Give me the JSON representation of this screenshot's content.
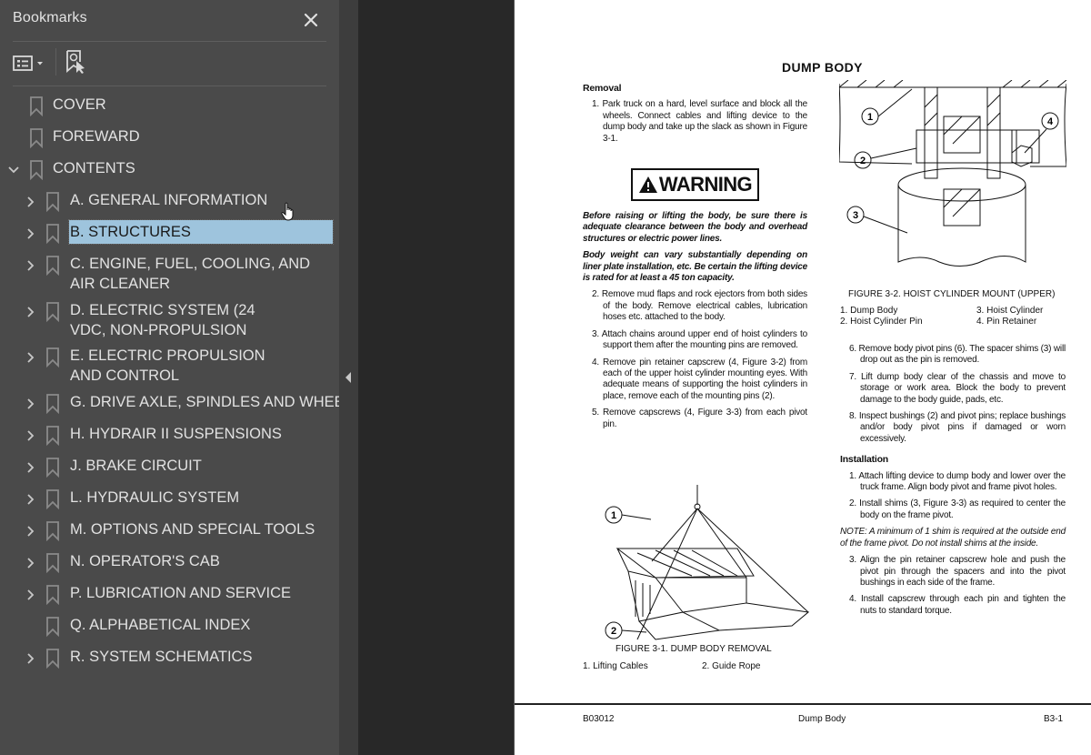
{
  "sidebar": {
    "title": "Bookmarks",
    "close_icon": "close-x-icon",
    "toolbar": {
      "options_icon": "list-options-icon",
      "find_icon": "find-current-bookmark-icon"
    },
    "items": [
      {
        "label": "COVER",
        "level": 0,
        "expandable": false,
        "expanded": false
      },
      {
        "label": "FOREWARD",
        "level": 0,
        "expandable": false,
        "expanded": false
      },
      {
        "label": "CONTENTS",
        "level": 0,
        "expandable": true,
        "expanded": true
      },
      {
        "label": "A. GENERAL INFORMATION",
        "level": 1,
        "expandable": true,
        "expanded": false
      },
      {
        "label": "B. STRUCTURES",
        "level": 1,
        "expandable": true,
        "expanded": false,
        "selected": true
      },
      {
        "label": "C. ENGINE, FUEL, COOLING, AND AIR CLEANER",
        "level": 1,
        "expandable": true,
        "expanded": false
      },
      {
        "label": "D. ELECTRIC SYSTEM (24 VDC, NON-PROPULSION",
        "level": 1,
        "expandable": true,
        "expanded": false
      },
      {
        "label": "E. ELECTRIC PROPULSION AND CONTROL",
        "level": 1,
        "expandable": true,
        "expanded": false
      },
      {
        "label": "G. DRIVE AXLE, SPINDLES AND WHEELS",
        "level": 1,
        "expandable": true,
        "expanded": false
      },
      {
        "label": "H. HYDRAIR II SUSPENSIONS",
        "level": 1,
        "expandable": true,
        "expanded": false
      },
      {
        "label": "J. BRAKE CIRCUIT",
        "level": 1,
        "expandable": true,
        "expanded": false
      },
      {
        "label": "L. HYDRAULIC SYSTEM",
        "level": 1,
        "expandable": true,
        "expanded": false
      },
      {
        "label": "M. OPTIONS AND SPECIAL TOOLS",
        "level": 1,
        "expandable": true,
        "expanded": false
      },
      {
        "label": "N. OPERATOR'S CAB",
        "level": 1,
        "expandable": true,
        "expanded": false
      },
      {
        "label": "P. LUBRICATION AND SERVICE",
        "level": 1,
        "expandable": true,
        "expanded": false
      },
      {
        "label": "Q. ALPHABETICAL INDEX",
        "level": 1,
        "expandable": false,
        "expanded": false
      },
      {
        "label": "R. SYSTEM SCHEMATICS",
        "level": 1,
        "expandable": true,
        "expanded": false
      }
    ],
    "selection_color": "#9ec4dd"
  },
  "document": {
    "title": "DUMP BODY",
    "removal": {
      "heading": "Removal",
      "step1": "1. Park truck on a hard, level surface and block all the wheels. Connect cables and lifting device to the dump body and take up the slack as shown in Figure 3-1.",
      "warning_label": "WARNING",
      "warning1": "Before raising or lifting the body, be sure there is adequate clearance between the body and overhead structures or electric power lines.",
      "warning2": "Body weight can vary substantially depending on liner plate installation, etc. Be certain the lifting device is rated for at least a 45 ton capacity.",
      "step2": "2. Remove mud flaps and rock ejectors from both sides of the body. Remove electrical cables, lubrication hoses etc. attached to the body.",
      "step3": "3. Attach chains around upper end of hoist cylinders to support them after the mounting pins are removed.",
      "step4": "4. Remove pin retainer capscrew (4, Figure 3-2) from each of the upper hoist cylinder mounting eyes. With adequate means of supporting the hoist cylinders in place, remove each of the mounting pins (2).",
      "step5": "5. Remove capscrews (4, Figure 3-3) from each pivot pin.",
      "step6": "6. Remove body pivot pins (6). The spacer shims (3) will drop out as the pin is removed.",
      "step7": "7. Lift dump body clear of the chassis and move to storage or work area. Block the body to prevent damage to the body guide, pads, etc.",
      "step8": "8. Inspect bushings (2) and pivot pins; replace bushings and/or body pivot pins if damaged or worn excessively."
    },
    "installation": {
      "heading": "Installation",
      "step1": "1. Attach lifting device to dump body and lower over the truck frame. Align body pivot and frame pivot holes.",
      "step2": "2. Install shims (3, Figure 3-3) as required to center the body on the frame pivot.",
      "note": "NOTE: A minimum of 1 shim is required at the outside end of the frame pivot. Do not install shims at the inside.",
      "step3": "3. Align the pin retainer capscrew hole and push the pivot pin through the spacers and into the pivot bushings in each side of the frame.",
      "step4": "4. Install capscrew through each pin and tighten the nuts to standard torque."
    },
    "figure1": {
      "caption": "FIGURE 3-1. DUMP BODY REMOVAL",
      "callouts": [
        "1",
        "2"
      ],
      "legend": [
        "1. Lifting Cables",
        "2. Guide Rope"
      ]
    },
    "figure2": {
      "caption": "FIGURE 3-2. HOIST CYLINDER MOUNT (UPPER)",
      "callouts": [
        "1",
        "2",
        "3",
        "4"
      ],
      "legend": [
        "1. Dump Body",
        "2. Hoist Cylinder Pin",
        "3. Hoist Cylinder",
        "4. Pin Retainer"
      ]
    },
    "footer": {
      "left": "B03012",
      "center": "Dump Body",
      "right": "B3-1"
    }
  }
}
